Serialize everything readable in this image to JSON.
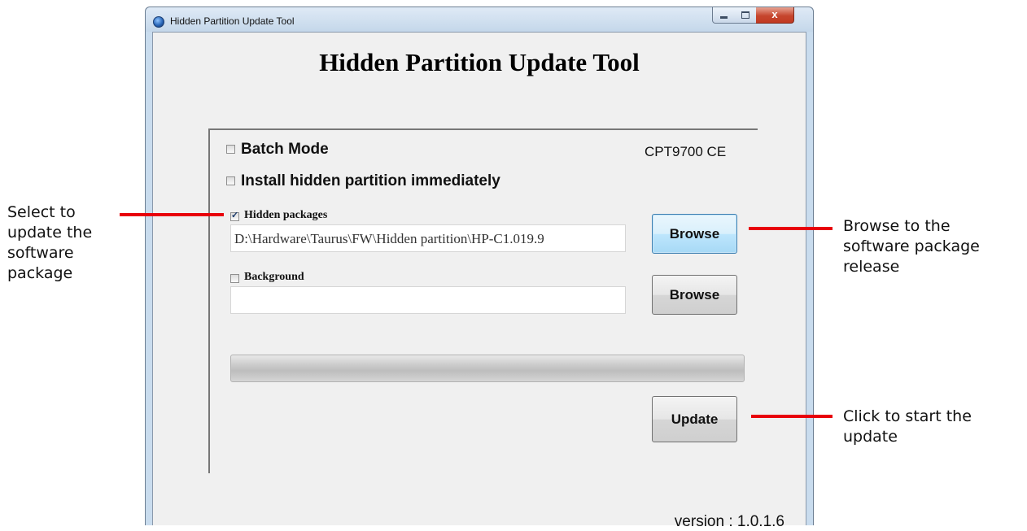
{
  "window": {
    "title": "Hidden Partition Update Tool",
    "close_glyph": "x"
  },
  "app": {
    "heading": "Hidden Partition Update Tool",
    "model": "CPT9700 CE",
    "version": "version : 1.0.1.6"
  },
  "options": {
    "batch_mode": {
      "label": "Batch Mode",
      "checked": false
    },
    "install_immediately": {
      "label": "Install hidden partition immediately",
      "checked": false
    }
  },
  "packages": {
    "hidden": {
      "label": "Hidden packages",
      "checked": true,
      "path": "D:\\Hardware\\Taurus\\FW\\Hidden partition\\HP-C1.019.9",
      "browse_label": "Browse"
    },
    "background": {
      "label": "Background",
      "checked": false,
      "path": "",
      "browse_label": "Browse"
    }
  },
  "progress": {
    "value": 0
  },
  "update_label": "Update",
  "annotations": {
    "left": [
      "Select to",
      "update the",
      "software",
      "package"
    ],
    "browse": [
      "Browse to the",
      "software package",
      "release"
    ],
    "update": [
      "Click to start the",
      "update"
    ]
  },
  "colors": {
    "annotation_line": "#e8000b",
    "focused_button": "#a7d9f5"
  },
  "icons": {
    "app": "globe-icon",
    "checkbox_checked": "check-icon"
  }
}
